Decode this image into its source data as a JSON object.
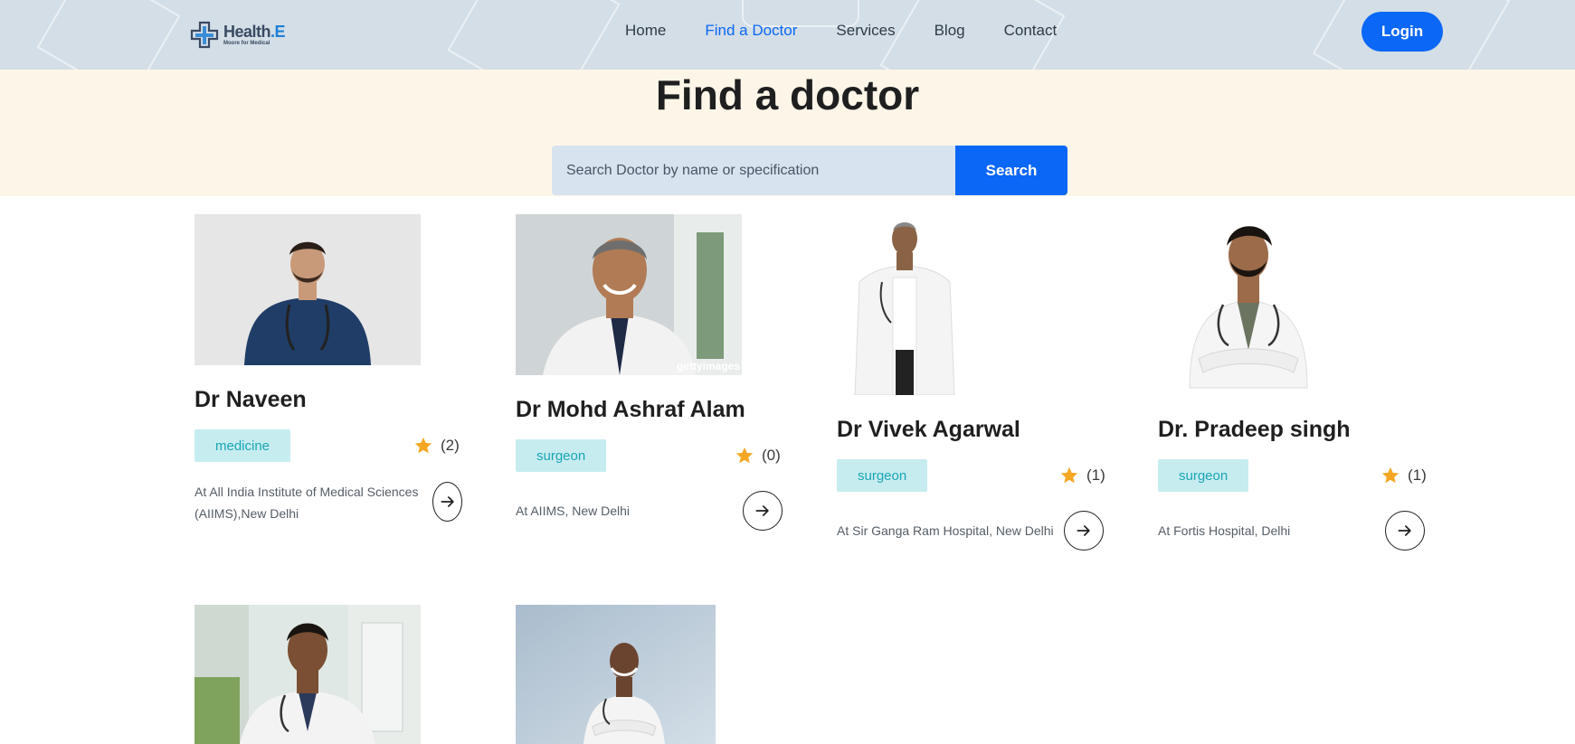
{
  "header": {
    "logo": {
      "name": "Health",
      "name_suffix": ".E",
      "tagline": "Moore for Medical"
    },
    "nav": [
      {
        "label": "Home",
        "active": false
      },
      {
        "label": "Find a Doctor",
        "active": true
      },
      {
        "label": "Services",
        "active": false
      },
      {
        "label": "Blog",
        "active": false
      },
      {
        "label": "Contact",
        "active": false
      }
    ],
    "login_label": "Login"
  },
  "hero": {
    "title": "Find a doctor",
    "search_placeholder": "Search Doctor by name or specification",
    "search_button": "Search"
  },
  "colors": {
    "accent": "#0b67f5",
    "tag_bg": "#c7ecf0",
    "tag_text": "#1aa6b3",
    "star": "#f5a623",
    "hero_bg": "#fdf6e8"
  },
  "doctors": [
    {
      "name": "Dr Naveen",
      "specialty": "medicine",
      "rating_count": "(2)",
      "location": "At All India Institute of Medical Sciences (AIIMS),New Delhi",
      "photo_icon": "doctor-portrait"
    },
    {
      "name": "Dr Mohd Ashraf Alam",
      "specialty": "surgeon",
      "rating_count": "(0)",
      "location": "At AIIMS, New Delhi",
      "photo_icon": "doctor-portrait",
      "watermark": "gettyimages"
    },
    {
      "name": "Dr Vivek Agarwal",
      "specialty": "surgeon",
      "rating_count": "(1)",
      "location": "At Sir Ganga Ram Hospital, New Delhi",
      "photo_icon": "doctor-portrait"
    },
    {
      "name": "Dr. Pradeep singh",
      "specialty": "surgeon",
      "rating_count": "(1)",
      "location": "At Fortis Hospital, Delhi",
      "photo_icon": "doctor-portrait"
    },
    {
      "photo_icon": "doctor-portrait"
    },
    {
      "photo_icon": "doctor-portrait"
    }
  ]
}
